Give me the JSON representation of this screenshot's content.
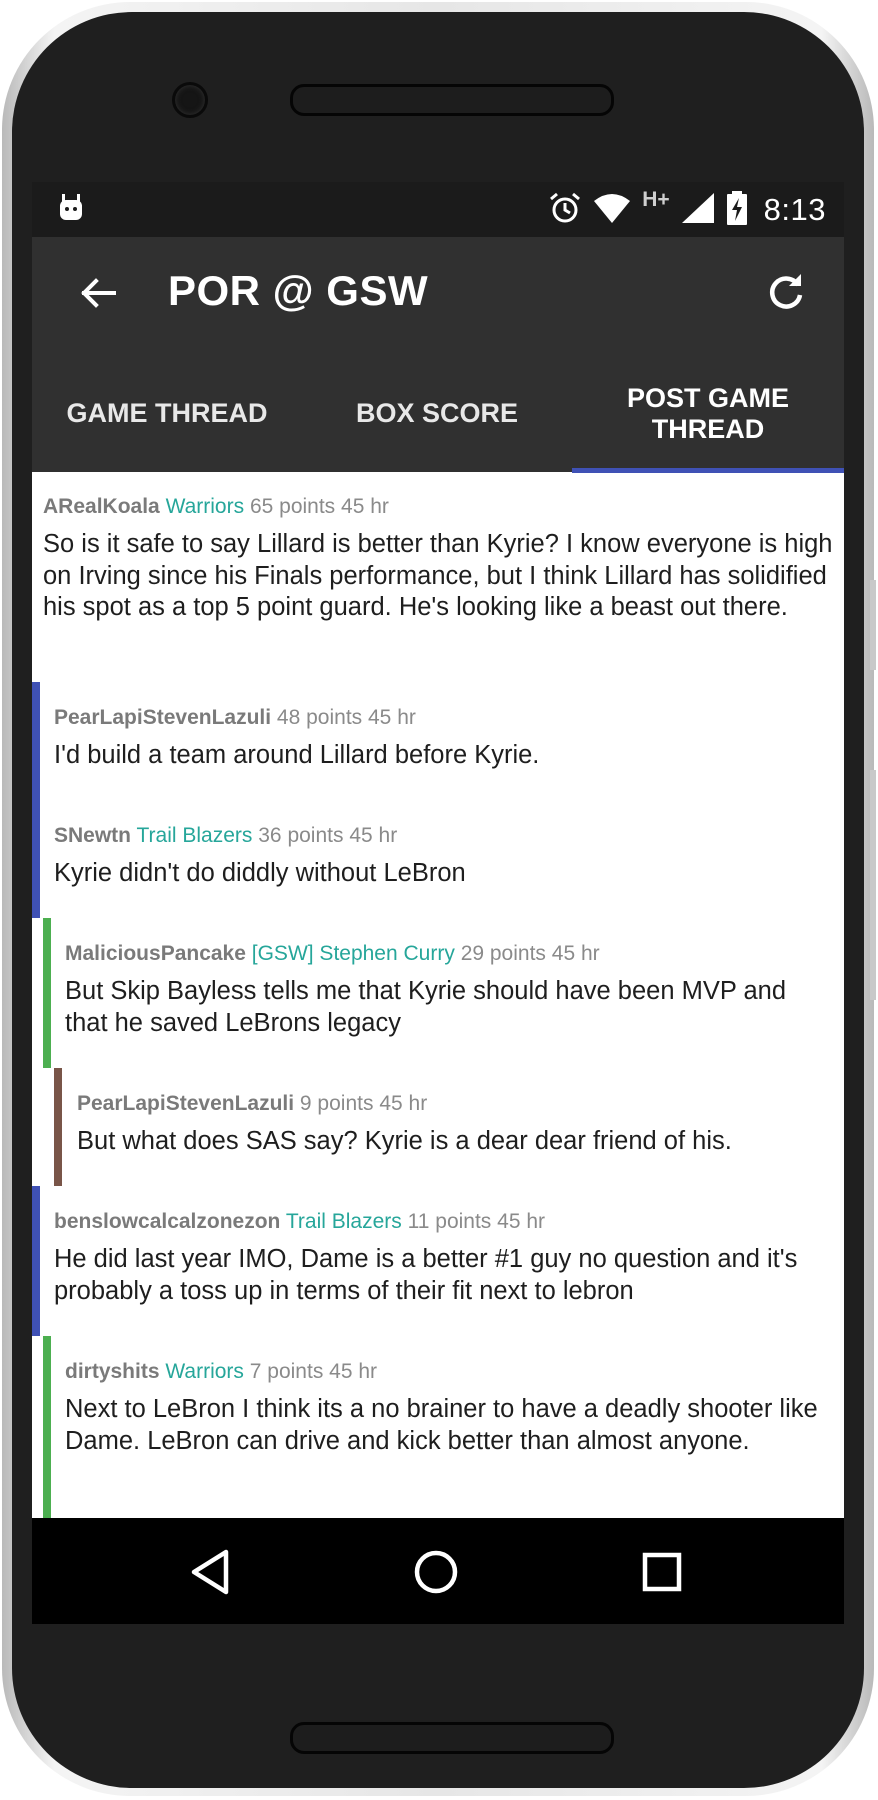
{
  "status_bar": {
    "time": "8:13",
    "network": "H+",
    "icons": [
      "android-icon",
      "alarm-icon",
      "wifi-icon",
      "signal-icon",
      "battery-charging-icon"
    ]
  },
  "toolbar": {
    "title": "POR @ GSW",
    "back_icon": "arrow-left-icon",
    "refresh_icon": "refresh-icon"
  },
  "tabs": [
    {
      "label": "GAME THREAD",
      "selected": false
    },
    {
      "label": "BOX SCORE",
      "selected": false
    },
    {
      "label": "POST GAME THREAD",
      "selected": true
    }
  ],
  "colors": {
    "app_bar": "#303030",
    "status_bar": "#1b1b1b",
    "tab_indicator": "#3f51b5",
    "flair": "#26a69a",
    "depth1": "#3f51b5",
    "depth2": "#4caf50",
    "depth3": "#795548"
  },
  "comments": [
    {
      "author": "ARealKoala",
      "flair": "Warriors",
      "points": "65 points",
      "time": "45 hr",
      "depth": 0,
      "body": "So is it safe to say Lillard is better than Kyrie? I know everyone is high on Irving since his Finals performance, but I think Lillard has solidified his spot as a top 5 point guard.  He's looking like a beast out there."
    },
    {
      "author": "PearLapiStevenLazuli",
      "flair": "",
      "points": "48 points",
      "time": "45 hr",
      "depth": 1,
      "body": "I'd build a team around Lillard before Kyrie."
    },
    {
      "author": "SNewtn",
      "flair": "Trail Blazers",
      "points": "36 points",
      "time": "45 hr",
      "depth": 1,
      "body": "Kyrie didn't do diddly without LeBron"
    },
    {
      "author": "MaliciousPancake",
      "flair": "[GSW] Stephen Curry",
      "points": "29 points",
      "time": "45 hr",
      "depth": 2,
      "body": "But Skip Bayless tells me that Kyrie should have been MVP and that he saved LeBrons legacy"
    },
    {
      "author": "PearLapiStevenLazuli",
      "flair": "",
      "points": "9 points",
      "time": "45 hr",
      "depth": 3,
      "body": "But what does SAS say? Kyrie is a dear dear friend of his."
    },
    {
      "author": "benslowcalcalzonezon",
      "flair": "Trail Blazers",
      "points": "11 points",
      "time": "45 hr",
      "depth": 1,
      "body": "He did last year IMO, Dame is a better #1 guy no question and it's probably a toss up in terms of their fit next to lebron"
    },
    {
      "author": "dirtyshits",
      "flair": "Warriors",
      "points": "7 points",
      "time": "45 hr",
      "depth": 2,
      "body": "Next to LeBron I think its a no brainer to have a deadly shooter like Dame. LeBron can drive and kick better than almost anyone."
    }
  ],
  "nav_bar": {
    "icons": [
      "nav-back-icon",
      "nav-home-icon",
      "nav-recents-icon"
    ]
  }
}
